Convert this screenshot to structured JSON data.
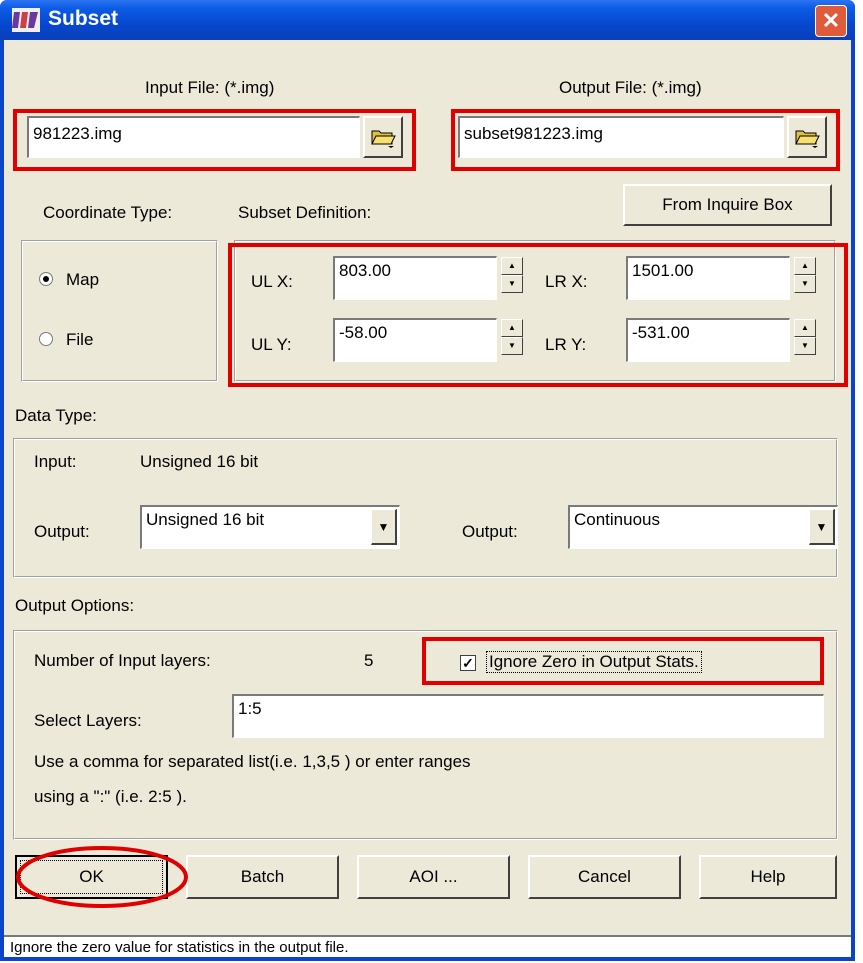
{
  "window": {
    "title": "Subset",
    "close_glyph": "✕"
  },
  "files": {
    "input_label": "Input File: (*.img)",
    "input_value": "981223.img",
    "output_label": "Output File: (*.img)",
    "output_value": "subset981223.img"
  },
  "coord": {
    "type_label": "Coordinate Type:",
    "subset_def_label": "Subset Definition:",
    "inquire_button": "From Inquire Box",
    "options": [
      "Map",
      "File"
    ],
    "selected": "Map",
    "ulx_label": "UL X:",
    "ulx_value": "803.00",
    "uly_label": "UL Y:",
    "uly_value": "-58.00",
    "lrx_label": "LR X:",
    "lrx_value": "1501.00",
    "lry_label": "LR Y:",
    "lry_value": "-531.00"
  },
  "datatype": {
    "section_label": "Data Type:",
    "input_label": "Input:",
    "input_value": "Unsigned 16 bit",
    "output_label": "Output:",
    "output_value": "Unsigned 16 bit",
    "output2_label": "Output:",
    "output2_value": "Continuous"
  },
  "options": {
    "section_label": "Output Options:",
    "num_layers_label": "Number of Input layers:",
    "num_layers_value": "5",
    "ignore_zero_label": "Ignore Zero in Output Stats.",
    "ignore_zero_checked": true,
    "select_layers_label": "Select Layers:",
    "select_layers_value": "1:5",
    "hint_line1": "Use a comma for separated list(i.e. 1,3,5 ) or enter ranges",
    "hint_line2": "using a \":\" (i.e. 2:5 )."
  },
  "buttons": {
    "ok": "OK",
    "batch": "Batch",
    "aoi": "AOI ...",
    "cancel": "Cancel",
    "help": "Help"
  },
  "status": "Ignore the zero value for statistics in the output file.",
  "colors": {
    "titlebar": "#0a4fd6",
    "dialog": "#ece9d8",
    "highlight": "#e00000"
  }
}
